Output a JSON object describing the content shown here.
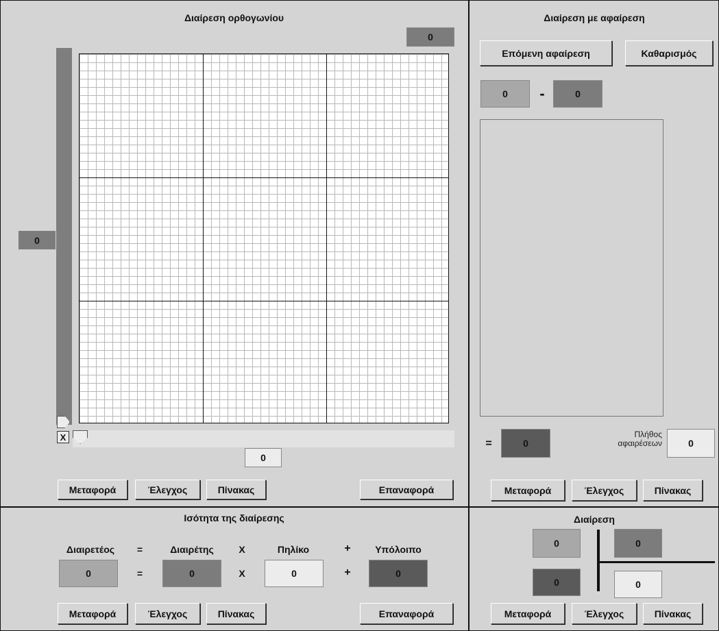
{
  "rect": {
    "title": "Διαίρεση ορθογωνίου",
    "top_value": "0",
    "left_value": "0",
    "bottom_value": "0",
    "x_label": "X",
    "buttons": {
      "transfer": "Μεταφορά",
      "check": "Έλεγχος",
      "table": "Πίνακας",
      "reset": "Επαναφορά"
    }
  },
  "subtract": {
    "title": "Διαίρεση με αφαίρεση",
    "next_button": "Επόμενη αφαίρεση",
    "clear_button": "Καθαρισμός",
    "left_value": "0",
    "minus": "-",
    "right_value": "0",
    "equals": "=",
    "result_value": "0",
    "count_label_1": "Πλήθος",
    "count_label_2": "αφαιρέσεων",
    "count_value": "0",
    "buttons": {
      "transfer": "Μεταφορά",
      "check": "Έλεγχος",
      "table": "Πίνακας"
    }
  },
  "equality": {
    "title": "Ισότητα της διαίρεσης",
    "headers": {
      "dividend": "Διαιρετέος",
      "eq": "=",
      "divisor": "Διαιρέτης",
      "times": "X",
      "quotient": "Πηλίκο",
      "plus": "+",
      "remainder": "Υπόλοιπο"
    },
    "values": {
      "dividend": "0",
      "eq": "=",
      "divisor": "0",
      "times": "X",
      "quotient": "0",
      "plus": "+",
      "remainder": "0"
    },
    "buttons": {
      "transfer": "Μεταφορά",
      "check": "Έλεγχος",
      "table": "Πίνακας",
      "reset": "Επαναφορά"
    }
  },
  "division": {
    "title": "Διαίρεση",
    "dividend": "0",
    "divisor": "0",
    "remainder": "0",
    "quotient": "0",
    "buttons": {
      "transfer": "Μεταφορά",
      "check": "Έλεγχος",
      "table": "Πίνακας"
    }
  }
}
